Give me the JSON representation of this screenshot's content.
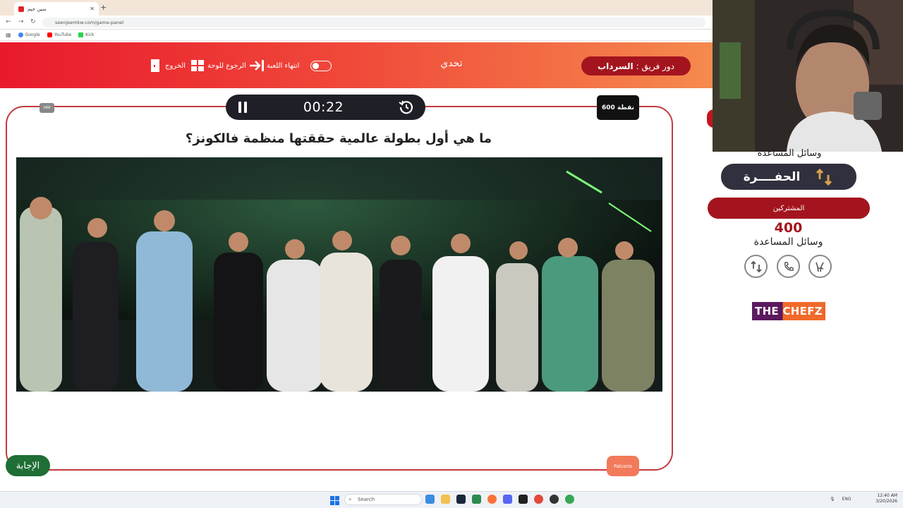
{
  "browser": {
    "tab_title": "سين جيم",
    "url": "seenjeemkw.com/game-panel",
    "bookmarks": [
      "Google",
      "YouTube",
      "Kick"
    ]
  },
  "header": {
    "turn_label": "دور فريق :",
    "team_name": "السرداب",
    "mode": "تحدي",
    "end_game": "انتهاء اللعبة",
    "back_to_board": "الرجوع للوحة",
    "exit": "الخروج"
  },
  "question_panel": {
    "timer": "00:22",
    "points": "600 نقطة",
    "var_badge": "VAR",
    "question": "ما هي أول بطولة عالمية حققتها منظمة فالكونز؟",
    "answer_button": "الإجابة",
    "category_tag": "Falcons"
  },
  "sidebar": {
    "helpers_title_top": "وسائل المساعدة",
    "hofra_label": "الحفــــرة",
    "participants_label": "المشتركين",
    "score": "400",
    "helpers_title": "وسائل المساعدة",
    "sponsor": "THE CHEFZ"
  },
  "taskbar": {
    "search_placeholder": "Search",
    "language": "ENG",
    "time": "12:40 AM",
    "date": "3/20/2026"
  },
  "colors": {
    "header_start": "#e8192c",
    "header_end": "#f58a4e",
    "dark_red": "#a4141e",
    "answer_green": "#1e6e36"
  }
}
